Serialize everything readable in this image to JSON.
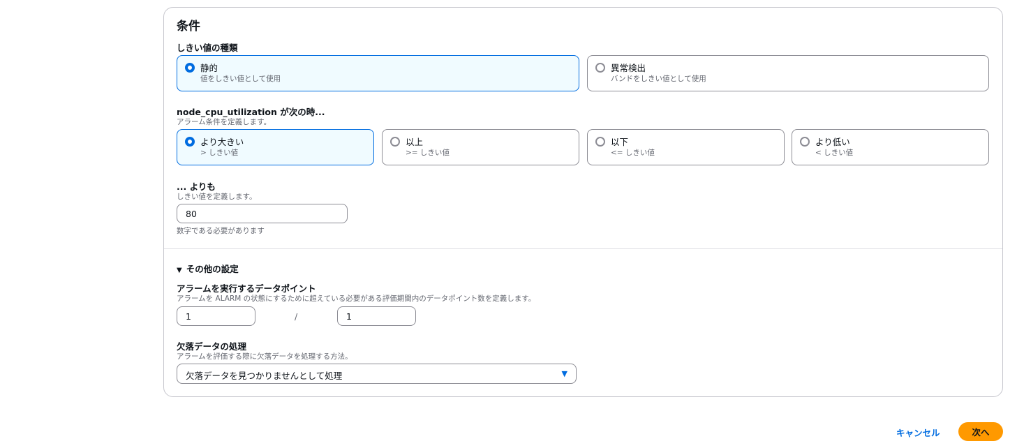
{
  "conditions": {
    "title": "条件",
    "threshold_type": {
      "label": "しきい値の種類",
      "options": [
        {
          "label": "静的",
          "desc": "値をしきい値として使用",
          "selected": true
        },
        {
          "label": "異常検出",
          "desc": "バンドをしきい値として使用",
          "selected": false
        }
      ]
    },
    "comparison": {
      "label": "node_cpu_utilization が次の時...",
      "desc": "アラーム条件を定義します。",
      "options": [
        {
          "label": "より大きい",
          "desc": "> しきい値",
          "selected": true
        },
        {
          "label": "以上",
          "desc": ">= しきい値",
          "selected": false
        },
        {
          "label": "以下",
          "desc": "<= しきい値",
          "selected": false
        },
        {
          "label": "より低い",
          "desc": "< しきい値",
          "selected": false
        }
      ]
    },
    "threshold_value": {
      "label": "... よりも",
      "desc": "しきい値を定義します。",
      "value": "80",
      "hint": "数字である必要があります"
    }
  },
  "additional": {
    "toggle_label": "その他の設定",
    "toggle_icon": "caret-down-icon",
    "datapoints": {
      "label": "アラームを実行するデータポイント",
      "desc": "アラームを ALARM の状態にするために超えている必要がある評価期間内のデータポイント数を定義します。",
      "value_left": "1",
      "separator": "/",
      "value_right": "1"
    },
    "missing_data": {
      "label": "欠落データの処理",
      "desc": "アラームを評価する際に欠落データを処理する方法。",
      "selected": "欠落データを見つかりませんとして処理"
    }
  },
  "footer": {
    "cancel_label": "キャンセル",
    "next_label": "次へ"
  },
  "colors": {
    "accent": "#006ce0",
    "primary_button": "#ff9900",
    "selected_tile_bg": "#f0fbff"
  }
}
